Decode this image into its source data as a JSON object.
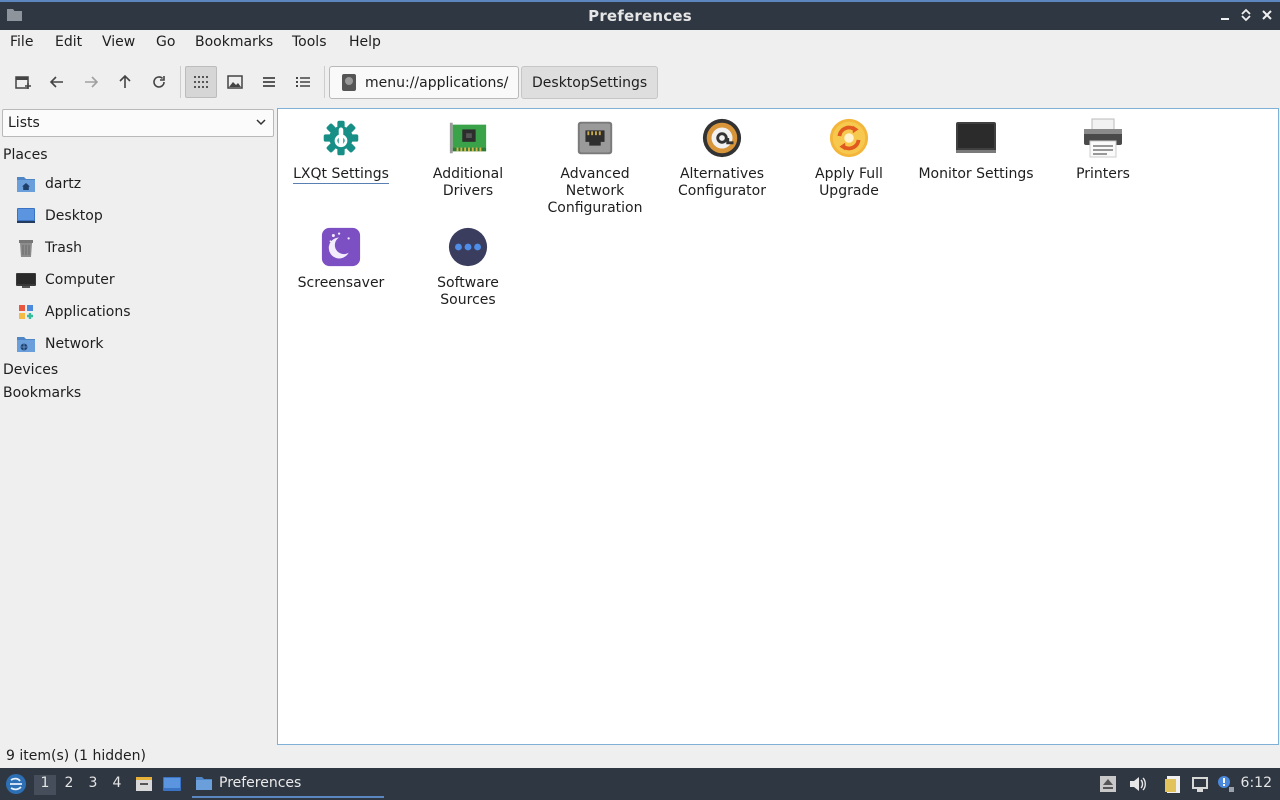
{
  "window": {
    "title": "Preferences"
  },
  "menubar": {
    "items": [
      "File",
      "Edit",
      "View",
      "Go",
      "Bookmarks",
      "Tools",
      "Help"
    ]
  },
  "toolbar": {
    "buttons": [
      "new-tab-icon",
      "back-arrow-icon",
      "forward-arrow-icon",
      "up-arrow-icon",
      "reload-icon",
      "icon-view-icon",
      "thumbnail-view-icon",
      "compact-view-icon",
      "detailed-list-view-icon"
    ],
    "active_view": "icon-view-icon",
    "path_segments": [
      "menu://applications/",
      "DesktopSettings"
    ]
  },
  "sidebar": {
    "select_value": "Lists",
    "places_label": "Places",
    "places": [
      {
        "label": "dartz",
        "icon": "home-folder-icon"
      },
      {
        "label": "Desktop",
        "icon": "desktop-icon"
      },
      {
        "label": "Trash",
        "icon": "trash-icon"
      },
      {
        "label": "Computer",
        "icon": "computer-icon"
      },
      {
        "label": "Applications",
        "icon": "applications-icon"
      },
      {
        "label": "Network",
        "icon": "network-folder-icon"
      }
    ],
    "devices_label": "Devices",
    "bookmarks_label": "Bookmarks"
  },
  "files": [
    {
      "line1": "LXQt Settings",
      "line2": "",
      "line3": "",
      "icon": "lxqt-settings-icon"
    },
    {
      "line1": "Additional",
      "line2": "Drivers",
      "line3": "",
      "icon": "hardware-card-icon"
    },
    {
      "line1": "Advanced",
      "line2": "Network",
      "line3": "Configuration",
      "icon": "network-port-icon"
    },
    {
      "line1": "Alternatives",
      "line2": "Configurator",
      "line3": "",
      "icon": "alternatives-icon"
    },
    {
      "line1": "Apply Full",
      "line2": "Upgrade",
      "line3": "",
      "icon": "upgrade-icon"
    },
    {
      "line1": "Monitor Settings",
      "line2": "",
      "line3": "",
      "icon": "monitor-icon"
    },
    {
      "line1": "Printers",
      "line2": "",
      "line3": "",
      "icon": "printer-icon"
    },
    {
      "line1": "Screensaver",
      "line2": "",
      "line3": "",
      "icon": "screensaver-icon"
    },
    {
      "line1": "Software",
      "line2": "Sources",
      "line3": "",
      "icon": "software-sources-icon"
    }
  ],
  "status": {
    "text": "9 item(s) (1 hidden)"
  },
  "panel": {
    "desktops": [
      "1",
      "2",
      "3",
      "4"
    ],
    "active_desktop": "1",
    "task_label": "Preferences",
    "clock": "6:12"
  }
}
